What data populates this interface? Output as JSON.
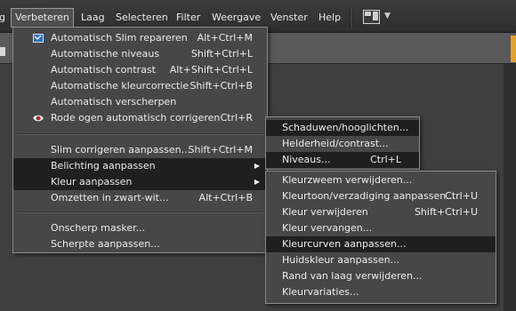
{
  "menubar": {
    "items": [
      "g",
      "Verbeteren",
      "Laag",
      "Selecteren",
      "Filter",
      "Weergave",
      "Venster",
      "Help"
    ],
    "layout_icon": "layout-grid-icon"
  },
  "enhance_menu": {
    "rows": [
      {
        "label": "Automatisch Slim repareren",
        "shortcut": "Alt+Ctrl+M",
        "icon": "smart-fix-icon"
      },
      {
        "label": "Automatische niveaus",
        "shortcut": "Shift+Ctrl+L"
      },
      {
        "label": "Automatisch contrast",
        "shortcut": "Alt+Shift+Ctrl+L"
      },
      {
        "label": "Automatische kleurcorrectie",
        "shortcut": "Shift+Ctrl+B"
      },
      {
        "label": "Automatisch verscherpen",
        "shortcut": ""
      },
      {
        "label": "Rode ogen automatisch corrigeren",
        "shortcut": "Ctrl+R",
        "icon": "red-eye-icon"
      },
      {
        "label": "Slim corrigeren aanpassen...",
        "shortcut": "Shift+Ctrl+M"
      },
      {
        "label": "Belichting aanpassen",
        "shortcut": ""
      },
      {
        "label": "Kleur aanpassen",
        "shortcut": ""
      },
      {
        "label": "Omzetten in zwart-wit...",
        "shortcut": "Alt+Ctrl+B"
      },
      {
        "label": "Onscherp masker...",
        "shortcut": ""
      },
      {
        "label": "Scherpte aanpassen...",
        "shortcut": ""
      }
    ]
  },
  "lighting_submenu": {
    "rows": [
      {
        "label": "Schaduwen/hooglichten...",
        "shortcut": ""
      },
      {
        "label": "Helderheid/contrast...",
        "shortcut": ""
      },
      {
        "label": "Niveaus...",
        "shortcut": "Ctrl+L"
      }
    ]
  },
  "color_submenu": {
    "rows": [
      {
        "label": "Kleurzweem verwijderen...",
        "shortcut": ""
      },
      {
        "label": "Kleurtoon/verzadiging aanpassen...",
        "shortcut": "Ctrl+U"
      },
      {
        "label": "Kleur verwijderen",
        "shortcut": "Shift+Ctrl+U"
      },
      {
        "label": "Kleur vervangen...",
        "shortcut": ""
      },
      {
        "label": "Kleurcurven aanpassen...",
        "shortcut": ""
      },
      {
        "label": "Huidskleur aanpassen...",
        "shortcut": ""
      },
      {
        "label": "Rand van laag verwijderen...",
        "shortcut": ""
      },
      {
        "label": "Kleurvariaties...",
        "shortcut": ""
      }
    ]
  },
  "colors": {
    "highlight": "#1f1f1f",
    "menu_bg": "#474747",
    "accent_strip": "#e6a127"
  }
}
